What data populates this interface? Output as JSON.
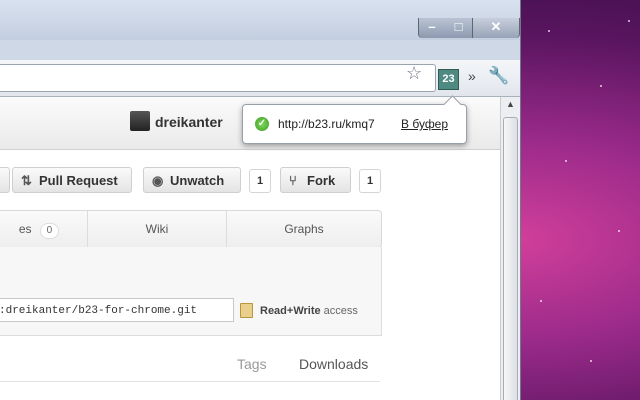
{
  "window": {
    "controls": {
      "minimize": "–",
      "maximize": "□",
      "close": "✕"
    }
  },
  "toolbar": {
    "extension_badge": "23",
    "icons": [
      "star-icon",
      "extension-icon",
      "chevron-icon",
      "wrench-icon"
    ]
  },
  "popup": {
    "short_url": "http://b23.ru/kmq7",
    "copy_label": "В буфер"
  },
  "header": {
    "username": "dreikanter"
  },
  "actions": {
    "pull_request": "Pull Request",
    "unwatch": "Unwatch",
    "unwatch_count": "1",
    "fork": "Fork",
    "fork_count": "1"
  },
  "tabs": [
    {
      "label": "es",
      "badge": "0"
    },
    {
      "label": "Wiki"
    },
    {
      "label": "Graphs"
    }
  ],
  "clone": {
    "url": ":dreikanter/b23-for-chrome.git",
    "access_bold": "Read+Write",
    "access_rest": " access"
  },
  "nav": {
    "tags": "Tags",
    "downloads": "Downloads"
  }
}
